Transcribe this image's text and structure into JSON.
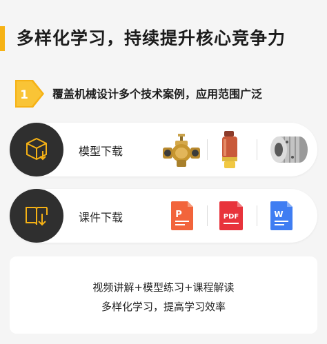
{
  "header": {
    "title": "多样化学习，持续提升核心竞争力",
    "accent_color": "#f6b215"
  },
  "intro": {
    "badge_number": "1",
    "text": "覆盖机械设计多个技术案例，应用范围广泛"
  },
  "downloads": [
    {
      "label": "模型下载",
      "icon": "box-download-icon",
      "thumbnails": [
        "valve-model",
        "cylinder-model",
        "coupling-model"
      ]
    },
    {
      "label": "课件下载",
      "icon": "book-download-icon",
      "thumbnails": [
        {
          "name": "ppt-file-icon",
          "letter": "P",
          "color": "#f2643b"
        },
        {
          "name": "pdf-file-icon",
          "letter": "PDF",
          "color": "#e8333b"
        },
        {
          "name": "word-file-icon",
          "letter": "W",
          "color": "#3f7df2"
        }
      ]
    }
  ],
  "footer": {
    "line1": "视频讲解+模型练习+课程解读",
    "line2": "多样化学习，提高学习效率"
  }
}
